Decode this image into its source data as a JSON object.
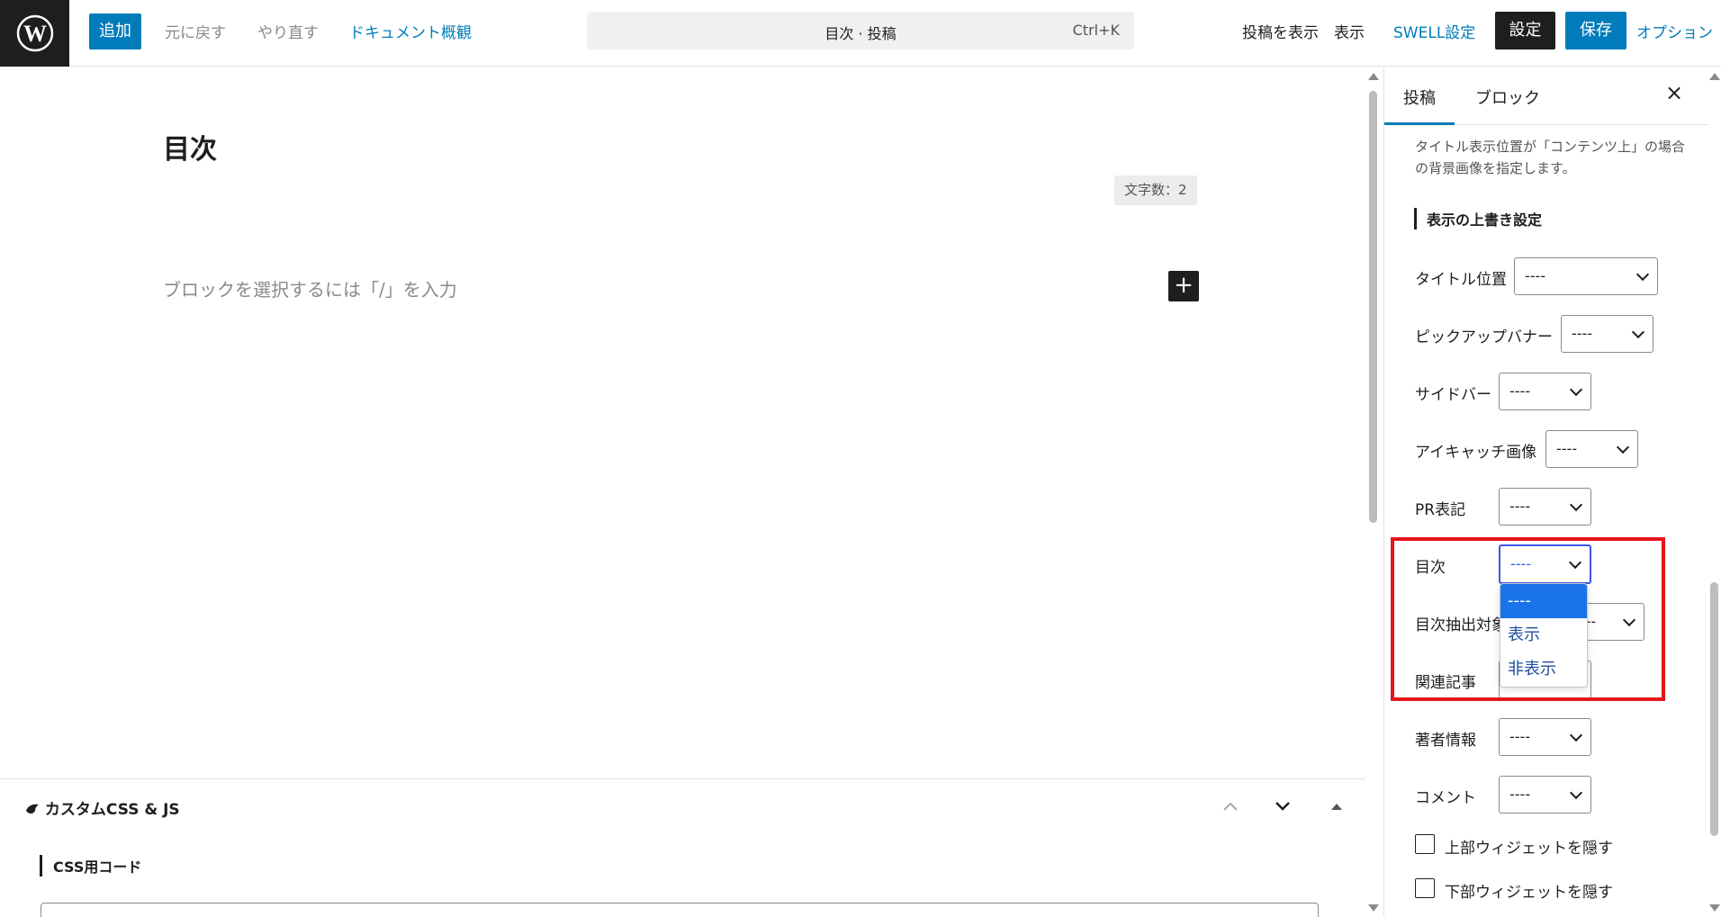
{
  "header": {
    "add_label": "追加",
    "undo_label": "元に戻す",
    "redo_label": "やり直す",
    "outline_label": "ドキュメント概観",
    "command_title": "目次 · 投稿",
    "command_shortcut": "Ctrl+K",
    "view_post_label": "投稿を表示",
    "preview_label": "表示",
    "swell_label": "SWELL設定",
    "settings_label": "設定",
    "save_label": "保存",
    "options_label": "オプション"
  },
  "editor": {
    "post_title": "目次",
    "word_count": "文字数：2",
    "block_placeholder": "ブロックを選択するには「/」を入力",
    "inserter_symbol": "+"
  },
  "metabox": {
    "title": "カスタムCSS & JS",
    "css_label": "CSS用コード"
  },
  "sidebar": {
    "tab_post": "投稿",
    "tab_block": "ブロック",
    "close_symbol": "×",
    "description": "タイトル表示位置が「コンテンツ上」の場合の背景画像を指定します。",
    "heading": "表示の上書き設定",
    "rows": [
      {
        "label": "タイトル位置",
        "value": "----"
      },
      {
        "label": "ピックアップバナー",
        "value": "----"
      },
      {
        "label": "サイドバー",
        "value": "----"
      },
      {
        "label": "アイキャッチ画像",
        "value": "----"
      },
      {
        "label": "PR表記",
        "value": "----"
      },
      {
        "label": "目次",
        "value": "----"
      },
      {
        "label": "目次抽出対象",
        "value": "----"
      },
      {
        "label": "関連記事",
        "value": "----"
      },
      {
        "label": "著者情報",
        "value": "----"
      },
      {
        "label": "コメント",
        "value": "----"
      }
    ],
    "checkboxes": [
      {
        "label": "上部ウィジェットを隠す",
        "checked": false
      },
      {
        "label": "下部ウィジェットを隠す",
        "checked": false
      }
    ]
  },
  "toc_dropdown": {
    "options": [
      "----",
      "表示",
      "非表示"
    ],
    "selected": "----"
  },
  "colors": {
    "accent": "#007cba",
    "highlight": "#e8141b",
    "focus": "#3858e9"
  }
}
